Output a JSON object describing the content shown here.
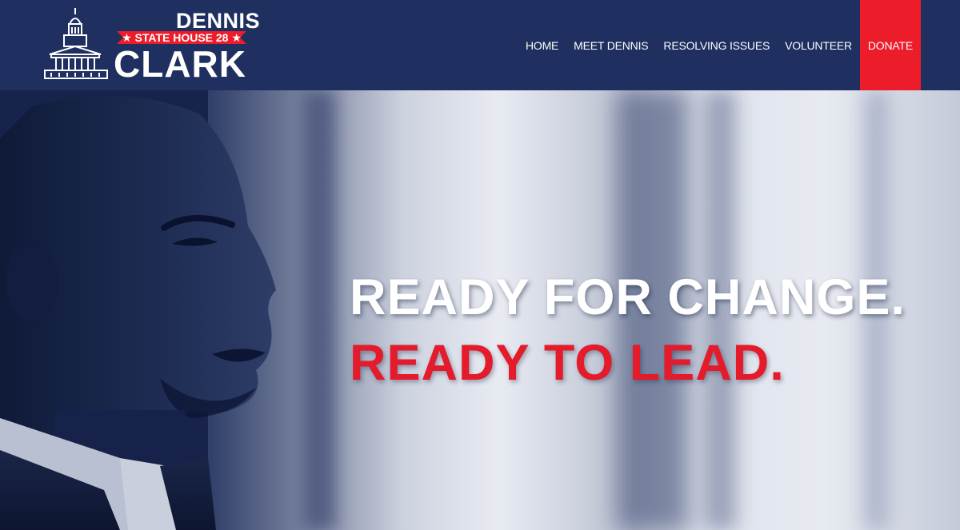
{
  "logo": {
    "first_name": "DENNIS",
    "banner": "★ STATE HOUSE 28 ★",
    "last_name": "CLARK",
    "icon": "capitol-building-icon"
  },
  "nav": {
    "items": [
      {
        "label": "HOME"
      },
      {
        "label": "MEET DENNIS"
      },
      {
        "label": "RESOLVING ISSUES"
      },
      {
        "label": "VOLUNTEER"
      },
      {
        "label": "DONATE"
      }
    ]
  },
  "hero": {
    "headline_line1": "READY FOR CHANGE.",
    "headline_line2": "READY TO LEAD."
  },
  "colors": {
    "navy": "#1f2f5f",
    "red": "#ec1c2b",
    "white": "#ffffff"
  }
}
